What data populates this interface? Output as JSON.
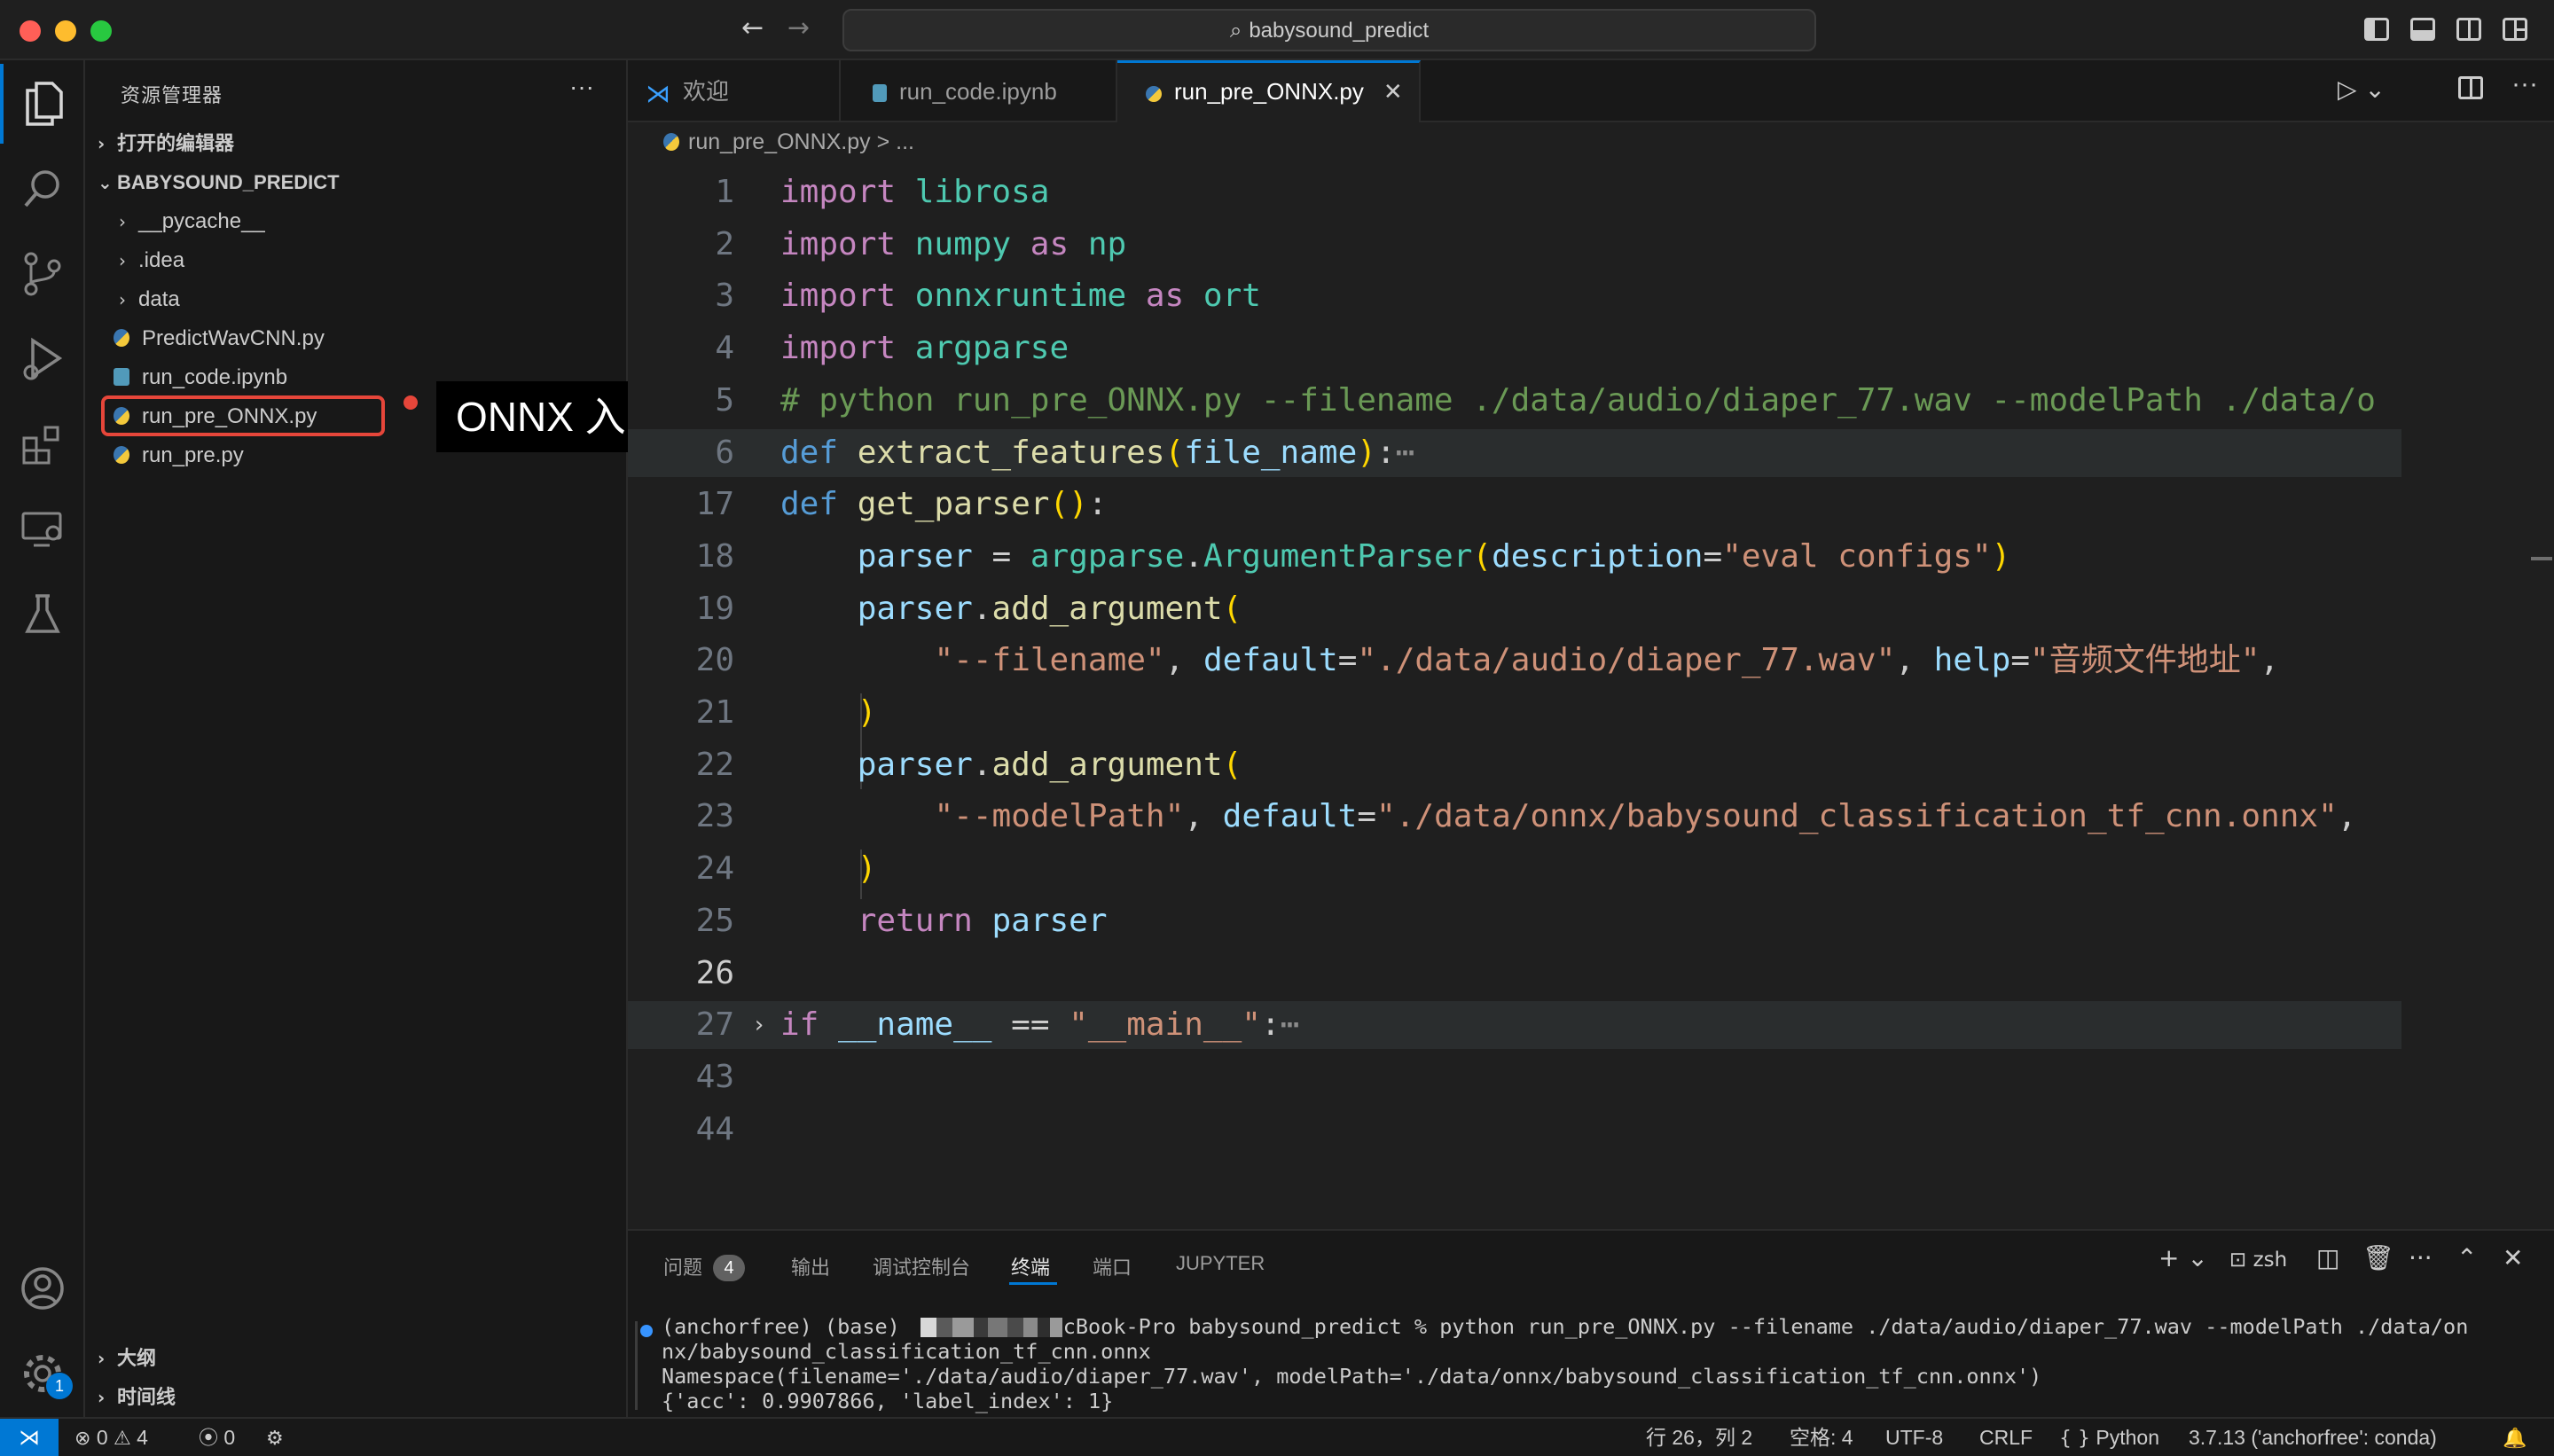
{
  "window": {
    "search_text": "babysound_predict"
  },
  "sidebar": {
    "title": "资源管理器",
    "more": "···",
    "open_editors": "打开的编辑器",
    "project": "BABYSOUND_PREDICT",
    "items": [
      {
        "label": "__pycache__",
        "kind": "folder"
      },
      {
        "label": ".idea",
        "kind": "folder"
      },
      {
        "label": "data",
        "kind": "folder"
      },
      {
        "label": "PredictWavCNN.py",
        "kind": "py"
      },
      {
        "label": "run_code.ipynb",
        "kind": "ipynb"
      },
      {
        "label": "run_pre_ONNX.py",
        "kind": "py"
      },
      {
        "label": "run_pre.py",
        "kind": "py"
      }
    ],
    "outline": "大纲",
    "timeline": "时间线"
  },
  "annotation": {
    "callout_text": "ONNX 入口文件",
    "accent_color": "#e6463a"
  },
  "tabs": [
    {
      "label": "欢迎",
      "icon": "vscode-icon"
    },
    {
      "label": "run_code.ipynb",
      "icon": "notebook-icon"
    },
    {
      "label": "run_pre_ONNX.py",
      "icon": "python-icon",
      "active": true
    }
  ],
  "breadcrumb": {
    "file": "run_pre_ONNX.py",
    "rest": "> ..."
  },
  "editor": {
    "lines": [
      {
        "n": "1",
        "text": "import librosa"
      },
      {
        "n": "2",
        "text": "import numpy as np"
      },
      {
        "n": "3",
        "text": "import onnxruntime as ort"
      },
      {
        "n": "4",
        "text": "import argparse"
      },
      {
        "n": "5",
        "text": "# python run_pre_ONNX.py --filename ./data/audio/diaper_77.wav --modelPath ./data/o"
      },
      {
        "n": "6",
        "text": "def extract_features(file_name):…"
      },
      {
        "n": "17",
        "text": "def get_parser():"
      },
      {
        "n": "18",
        "text": "    parser = argparse.ArgumentParser(description=\"eval configs\")"
      },
      {
        "n": "19",
        "text": "    parser.add_argument("
      },
      {
        "n": "20",
        "text": "        \"--filename\", default=\"./data/audio/diaper_77.wav\", help=\"音频文件地址\","
      },
      {
        "n": "21",
        "text": "    )"
      },
      {
        "n": "22",
        "text": "    parser.add_argument("
      },
      {
        "n": "23",
        "text": "        \"--modelPath\", default=\"./data/onnx/babysound_classification_tf_cnn.onnx\","
      },
      {
        "n": "24",
        "text": "    )"
      },
      {
        "n": "25",
        "text": "    return parser"
      },
      {
        "n": "26",
        "text": ""
      },
      {
        "n": "27",
        "text": "if __name__ == \"__main__\":…"
      },
      {
        "n": "43",
        "text": ""
      },
      {
        "n": "44",
        "text": ""
      }
    ]
  },
  "panel": {
    "tabs": [
      "问题",
      "输出",
      "调试控制台",
      "终端",
      "端口",
      "JUPYTER"
    ],
    "problems_count": "4",
    "active_tab": "终端",
    "shell": "zsh",
    "terminal": [
      "(anchorfree) (base)           MacBook-Pro babysound_predict % python run_pre_ONNX.py --filename ./data/audio/diaper_77.wav --modelPath ./data/on",
      "nx/babysound_classification_tf_cnn.onnx",
      "Namespace(filename='./data/audio/diaper_77.wav', modelPath='./data/onnx/babysound_classification_tf_cnn.onnx')",
      "{'acc': 0.9907866, 'label_index': 1}"
    ]
  },
  "statusbar": {
    "errors": "0",
    "warnings": "4",
    "ports": "0",
    "position": "行 26，列 2",
    "spaces": "空格: 4",
    "encoding": "UTF-8",
    "eol": "CRLF",
    "language": "Python",
    "interpreter": "3.7.13 ('anchorfree': conda)",
    "settings_badge": "1"
  }
}
